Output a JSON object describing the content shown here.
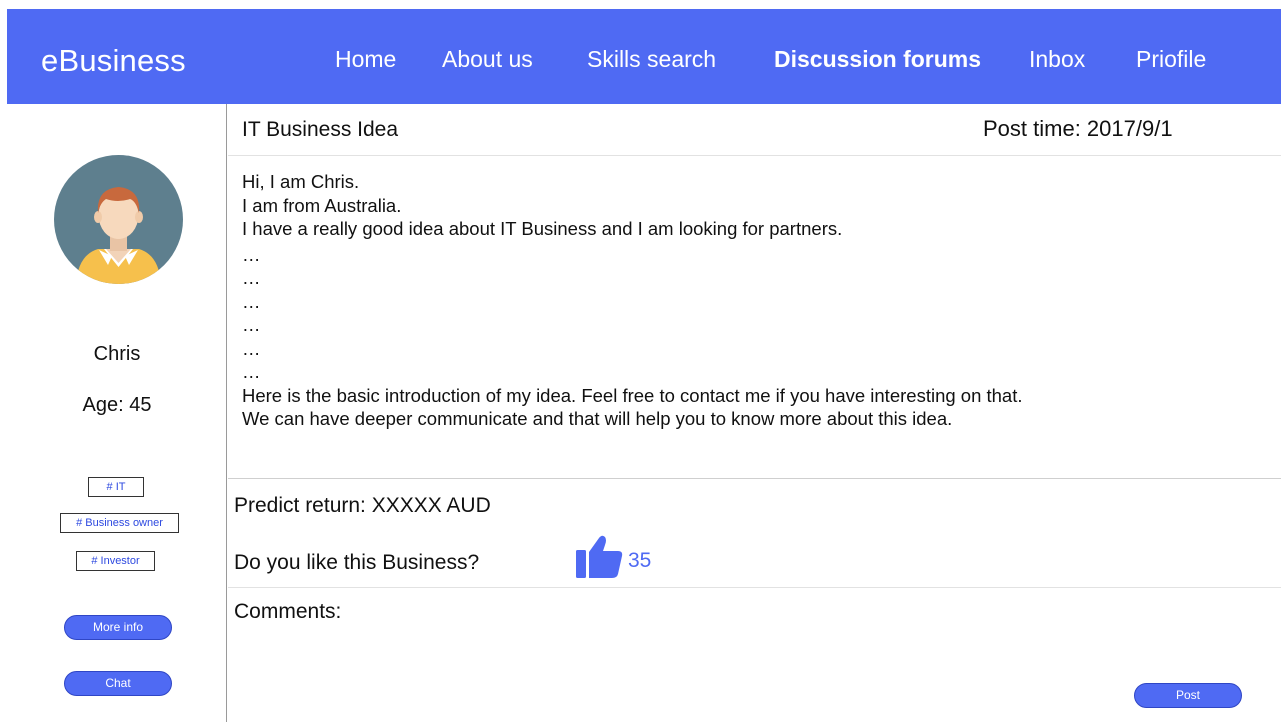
{
  "app": {
    "brand": "eBusiness"
  },
  "nav": {
    "items": [
      {
        "label": "Home",
        "active": false
      },
      {
        "label": "About us",
        "active": false
      },
      {
        "label": "Skills search",
        "active": false
      },
      {
        "label": "Discussion forums",
        "active": true
      },
      {
        "label": "Inbox",
        "active": false
      },
      {
        "label": "Priofile",
        "active": false
      }
    ]
  },
  "profile": {
    "avatar_icon": "user-avatar-icon",
    "name": "Chris",
    "age": "Age: 45",
    "tags": [
      "# IT",
      "# Business owner",
      "# Investor"
    ],
    "more_info_label": "More info",
    "chat_label": "Chat"
  },
  "post": {
    "title": "IT Business Idea",
    "time": "Post time: 2017/9/1",
    "body_lines": [
      "Hi,  I am Chris.",
      "I am from Australia.",
      "I have a really good idea about IT Business and I am looking for partners.",
      "…",
      "…",
      "…",
      "…",
      "…",
      "…",
      "Here is the basic introduction of my idea. Feel free to contact me if you have interesting on that.",
      "We can have deeper communicate and that will help you to know more about this idea."
    ],
    "predict_return": "Predict return: XXXXX AUD",
    "like_question": "Do you like this Business?",
    "like_icon": "thumbs-up-icon",
    "like_count": "35",
    "comments_label": "Comments:",
    "post_button_label": "Post"
  },
  "colors": {
    "accent": "#4f6af3",
    "tag_text": "#2d49e0",
    "avatar_bg": "#5e7f8e",
    "shirt": "#f6c04c"
  }
}
